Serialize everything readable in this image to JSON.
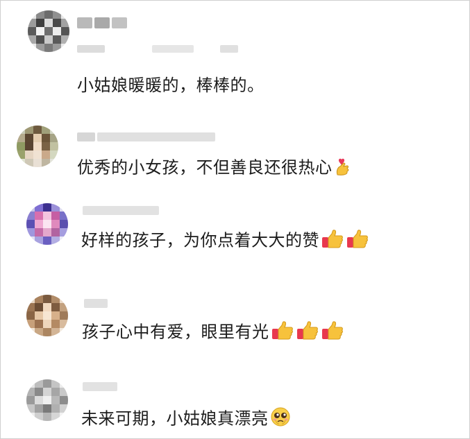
{
  "comments": [
    {
      "text": "小姑娘暖暖的，棒棒的。",
      "emojis": [],
      "avatar_colors": [
        "#5a5a5a",
        "#e6e6e6",
        "#8d8d8d",
        "#b5b5b5"
      ]
    },
    {
      "text": "优秀的小女孩，不但善良还很热心",
      "emojis": [
        "heart-hands-icon"
      ],
      "avatar_colors": [
        "#c9b79a",
        "#7e8a5a",
        "#e9dccb",
        "#a79071"
      ]
    },
    {
      "text": "好样的孩子，为你点着大大的赞",
      "emojis": [
        "thumbs-up-icon",
        "thumbs-up-icon"
      ],
      "avatar_colors": [
        "#4a3fa0",
        "#c86aa8",
        "#e9b6d6",
        "#7f7fd8"
      ]
    },
    {
      "text": "孩子心中有爱，眼里有光",
      "emojis": [
        "thumbs-up-icon",
        "thumbs-up-icon",
        "thumbs-up-icon"
      ],
      "avatar_colors": [
        "#d2b48f",
        "#a07b5a",
        "#f0e2cf",
        "#6d5441"
      ]
    },
    {
      "text": "未来可期，小姑娘真漂亮",
      "emojis": [
        "pleading-face-icon"
      ],
      "avatar_colors": [
        "#bdbdbd",
        "#8e8e8e",
        "#dedede",
        "#6d6d6d"
      ]
    }
  ]
}
